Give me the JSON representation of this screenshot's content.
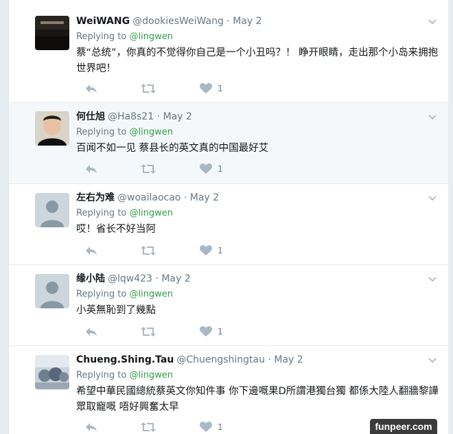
{
  "tweets": [
    {
      "name": "WeiWANG",
      "handle": "@dookiesWeiWang",
      "separator": "·",
      "date": "May 2",
      "replying_label": "Replying to",
      "replying_handle": "@lingwen",
      "text": "蔡“总统”，你真的不觉得你自己是一个小丑吗？！ 睁开眼睛，走出那个小岛来拥抱世界吧！",
      "like_count": "1"
    },
    {
      "name": "何仕旭",
      "handle": "@Ha8s21",
      "separator": "·",
      "date": "May 2",
      "replying_label": "Replying to",
      "replying_handle": "@lingwen",
      "text": "百闻不如一见 蔡县长的英文真的中国最好艾",
      "like_count": "1"
    },
    {
      "name": "左右为难",
      "handle": "@woailaocao",
      "separator": "·",
      "date": "May 2",
      "replying_label": "Replying to",
      "replying_handle": "@lingwen",
      "text": "哎！省长不好当阿",
      "like_count": "1"
    },
    {
      "name": "缘小陆",
      "handle": "@lqw423",
      "separator": "·",
      "date": "May 2",
      "replying_label": "Replying to",
      "replying_handle": "@lingwen",
      "text": "小英無恥到了幾點",
      "like_count": "1"
    },
    {
      "name": "Chueng.Shing.Tau",
      "handle": "@Chuengshingtau",
      "separator": "·",
      "date": "May 2",
      "replying_label": "Replying to",
      "replying_handle": "@lingwen",
      "text": "希望中華民國總統蔡英文你知件事 你下邊嘅果D所謂港獨台獨 都係大陸人翻牆黎譁眾取寵嘅 唔好興奮太早",
      "like_count": "1"
    }
  ],
  "watermark": "funpeer.com",
  "colors": {
    "mention": "#2f9f45",
    "icon_gray": "#aab8c2",
    "border": "#e6ecf0"
  }
}
